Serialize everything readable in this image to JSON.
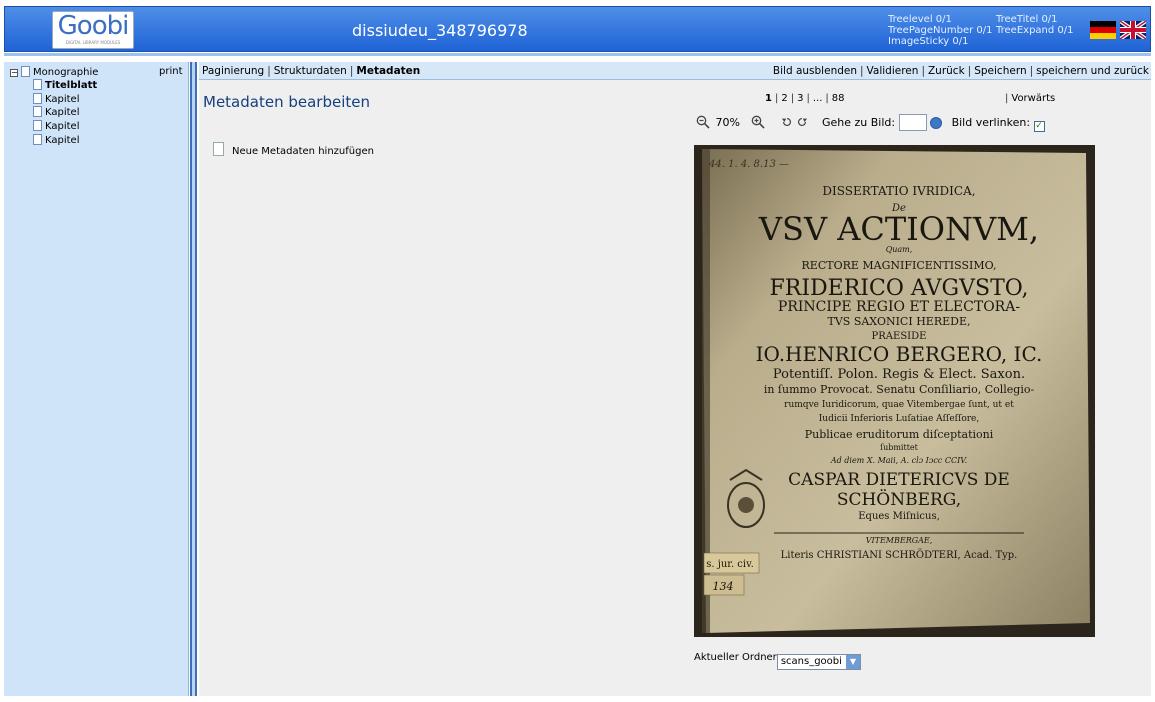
{
  "header": {
    "logo_text": "Goobi",
    "logo_subtitle": "DIGITAL LIBRARY MODULES",
    "title": "dissiudeu_348796978",
    "info_left": [
      "Treelevel 0/1",
      "TreePageNumber 0/1",
      "ImageSticky 0/1"
    ],
    "info_right": [
      "TreeTitel 0/1",
      "TreeExpand 0/1"
    ],
    "languages": [
      "de",
      "en"
    ]
  },
  "sidebar": {
    "root_label": "Monographie",
    "print_label": "print",
    "items": [
      {
        "label": "Titelblatt",
        "selected": true
      },
      {
        "label": "Kapitel"
      },
      {
        "label": "Kapitel"
      },
      {
        "label": "Kapitel"
      },
      {
        "label": "Kapitel"
      }
    ]
  },
  "tabs": {
    "items": [
      "Paginierung",
      "Strukturdaten",
      "Metadaten"
    ],
    "active": "Metadaten",
    "actions": [
      "Bild ausblenden",
      "Validieren",
      "Zurück",
      "Speichern",
      "speichern und zurück"
    ]
  },
  "content": {
    "title": "Metadaten bearbeiten",
    "new_metadata_label": "Neue Metadaten hinzufügen"
  },
  "image_viewer": {
    "pages": [
      "1",
      "2",
      "3",
      "...",
      "88"
    ],
    "current_page": "1",
    "forward_label": "Vorwärts",
    "zoom": "70%",
    "goto_label": "Gehe zu Bild:",
    "goto_value": "",
    "link_label": "Bild verlinken:",
    "link_checked": true,
    "folder_label": "Aktueller Ordner",
    "folder_value": "scans_goobi"
  },
  "scan_text": {
    "shelfmark": "44. 1. 4. 8.13 —",
    "line1": "DISSERTATIO IVRIDICA,",
    "line2": "De",
    "line3": "VSV ACTIONVM,",
    "line4": "Quam,",
    "line5": "RECTORE MAGNIFICENTISSIMO,",
    "line6": "FRIDERICO AVGVSTO,",
    "line7": "PRINCIPE REGIO ET ELECTORA-",
    "line8": "TVS SAXONICI HEREDE,",
    "line9": "PRAESIDE",
    "line10": "IO.HENRICO BERGERO, IC.",
    "line11": "Potentiſſ. Polon. Regis & Elect. Saxon.",
    "line12": "in ſummo Provocat. Senatu Conſiliario, Collegio-",
    "line13": "rumqve Iuridicorum, quae Vitembergae ſunt, ut et",
    "line14": "Iudicii Inferioris Luſatiae Aſſeſſore,",
    "line15": "Publicae eruditorum diſceptationi",
    "line16": "ſubmittet",
    "line17": "Ad diem X. Maii, A. clɔ Iɔcc CCIV.",
    "line18": "CASPAR DIETERICVS DE",
    "line19": "SCHÖNBERG,",
    "line20": "Eques Miſnicus,",
    "line21": "VITEMBERGAE,",
    "line22": "Literis CHRISTIANI SCHRÖDTERI, Acad. Typ.",
    "label1": "s. jur. civ.",
    "label2": "134"
  }
}
